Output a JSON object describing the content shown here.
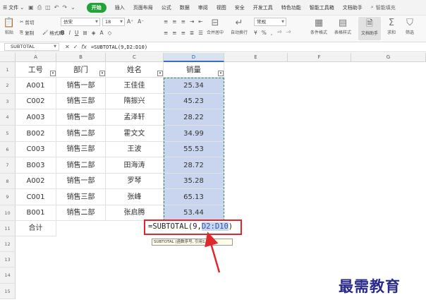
{
  "menubar": {
    "file": "文件",
    "items": [
      "开始",
      "插入",
      "页面布局",
      "公式",
      "数据",
      "审阅",
      "视图",
      "安全",
      "开发工具",
      "特色功能",
      "智能工具箱",
      "文档助手"
    ],
    "active_index": 0,
    "search": "智能填充"
  },
  "ribbon": {
    "paste": "粘贴",
    "cut": "剪切",
    "copy": "复制",
    "format_painter": "格式刷",
    "font_name": "仿宋",
    "font_size": "18",
    "merge": "合并居中",
    "wrap": "自动换行",
    "number_format": "常规",
    "conditional": "条件格式",
    "table_style": "表格样式",
    "doc_assist": "文档助手",
    "sum": "求和",
    "filter": "筛选"
  },
  "formula_bar": {
    "name_box": "SUBTOTAL",
    "fx": "fx",
    "content": "=SUBTOTAL(9,D2:D10)"
  },
  "columns": [
    "A",
    "B",
    "C",
    "D",
    "E",
    "F",
    "G"
  ],
  "rows": [
    "1",
    "2",
    "3",
    "4",
    "5",
    "6",
    "7",
    "8",
    "9",
    "10",
    "11",
    "12",
    "13",
    "14",
    "15"
  ],
  "table": {
    "headers": [
      "工号",
      "部门",
      "姓名",
      "销量"
    ],
    "rows": [
      [
        "A001",
        "销售一部",
        "王佳佳",
        "25.34"
      ],
      [
        "C002",
        "销售三部",
        "隋振兴",
        "45.23"
      ],
      [
        "A003",
        "销售一部",
        "孟泽轩",
        "28.22"
      ],
      [
        "B002",
        "销售二部",
        "霍文文",
        "34.99"
      ],
      [
        "C003",
        "销售三部",
        "王波",
        "55.53"
      ],
      [
        "B003",
        "销售二部",
        "田海涛",
        "28.72"
      ],
      [
        "A002",
        "销售一部",
        "罗琴",
        "35.28"
      ],
      [
        "C001",
        "销售三部",
        "张峰",
        "65.13"
      ],
      [
        "B001",
        "销售二部",
        "张启腾",
        "53.44"
      ]
    ],
    "total_label": "合计"
  },
  "formula_edit": {
    "prefix": "=SUBTOTAL(9,",
    "ref": "D2:D10",
    "suffix": ")"
  },
  "tooltip": "SUBTOTAL (函数序号, 引用1, ...)",
  "watermark": "最需教育",
  "colors": {
    "accent": "#21a336",
    "selection": "#c9d5ee",
    "highlight": "#e0272e"
  }
}
